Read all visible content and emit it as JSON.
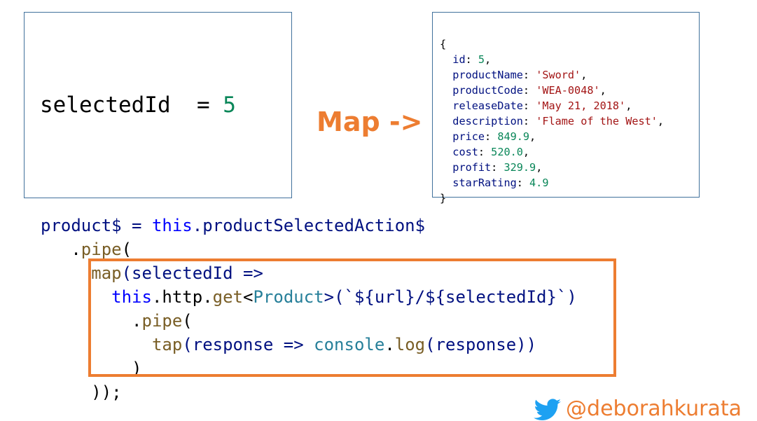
{
  "left_box": {
    "var_name": "selectedId",
    "op": "  = ",
    "value": "5"
  },
  "map_label": "Map ->",
  "object": {
    "open": "{",
    "fields": [
      {
        "key": "id",
        "value": "5",
        "kind": "num",
        "comma": ","
      },
      {
        "key": "productName",
        "value": "'Sword'",
        "kind": "str",
        "comma": ","
      },
      {
        "key": "productCode",
        "value": "'WEA-0048'",
        "kind": "str",
        "comma": ","
      },
      {
        "key": "releaseDate",
        "value": "'May 21, 2018'",
        "kind": "str",
        "comma": ","
      },
      {
        "key": "description",
        "value": "'Flame of the West'",
        "kind": "str",
        "comma": ","
      },
      {
        "key": "price",
        "value": "849.9",
        "kind": "num",
        "comma": ","
      },
      {
        "key": "cost",
        "value": "520.0",
        "kind": "num",
        "comma": ","
      },
      {
        "key": "profit",
        "value": "329.9",
        "kind": "num",
        "comma": ","
      },
      {
        "key": "starRating",
        "value": "4.9",
        "kind": "num",
        "comma": ""
      }
    ],
    "close": "}"
  },
  "code": {
    "line1": {
      "a": "product$ = ",
      "b": "this",
      "c": ".productSelectedAction$"
    },
    "line2": {
      "a": "   .",
      "b": "pipe",
      "c": "("
    },
    "line3": {
      "a": "     ",
      "b": "map",
      "c": "(selectedId =>"
    },
    "line4": {
      "a": "       ",
      "b": "this",
      "c": ".http.",
      "d": "get",
      "e": "<",
      "f": "Product",
      "g": ">(`${url}/${selectedId}`)"
    },
    "line5": {
      "a": "         .",
      "b": "pipe",
      "c": "("
    },
    "line6": {
      "a": "           ",
      "b": "tap",
      "c": "(response => ",
      "d": "console",
      "e": ".",
      "f": "log",
      "g": "(response))"
    },
    "line7": {
      "a": "         )"
    },
    "line8": {
      "a": "     ));"
    }
  },
  "footer": {
    "handle": "@deborahkurata"
  },
  "colors": {
    "accent": "#ed7d31",
    "box_border": "#41719c",
    "keyword": "#0000ff",
    "number": "#098658",
    "string": "#a31515"
  }
}
